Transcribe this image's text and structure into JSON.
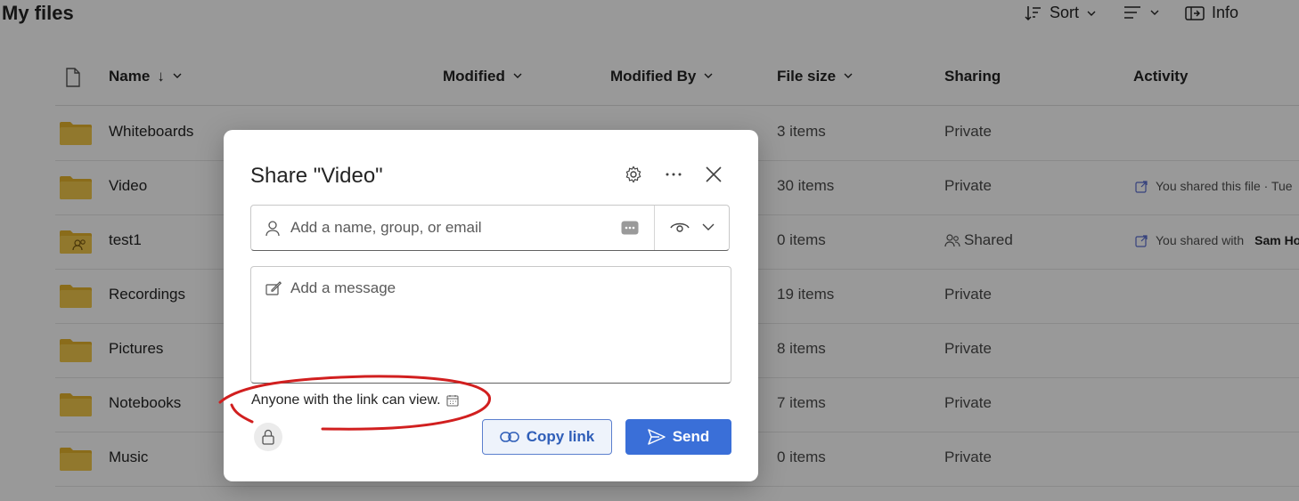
{
  "header": {
    "title": "My files",
    "sort_label": "Sort",
    "info_label": "Info"
  },
  "columns": {
    "name": "Name",
    "name_sort_arrow": "↓",
    "modified": "Modified",
    "modified_by": "Modified By",
    "file_size": "File size",
    "sharing": "Sharing",
    "activity": "Activity"
  },
  "rows": [
    {
      "name": "Whiteboards",
      "size": "3 items",
      "sharing": "Private",
      "activity": "",
      "activity_name": ""
    },
    {
      "name": "Video",
      "size": "30 items",
      "sharing": "Private",
      "activity": "You shared this file · Tue",
      "activity_name": ""
    },
    {
      "name": "test1",
      "size": "0 items",
      "sharing": "Shared",
      "activity": "You shared with",
      "activity_name": "Sam Ho"
    },
    {
      "name": "Recordings",
      "size": "19 items",
      "sharing": "Private",
      "activity": "",
      "activity_name": ""
    },
    {
      "name": "Pictures",
      "size": "8 items",
      "sharing": "Private",
      "activity": "",
      "activity_name": ""
    },
    {
      "name": "Notebooks",
      "size": "7 items",
      "sharing": "Private",
      "activity": "",
      "activity_name": ""
    },
    {
      "name": "Music",
      "size": "0 items",
      "sharing": "Private",
      "activity": "",
      "activity_name": ""
    }
  ],
  "dialog": {
    "title": "Share \"Video\"",
    "people_placeholder": "Add a name, group, or email",
    "message_placeholder": "Add a message",
    "link_info": "Anyone with the link can view.",
    "copy_link_label": "Copy link",
    "send_label": "Send",
    "icons": [
      "settings-icon",
      "more-icon",
      "close-icon",
      "person-icon",
      "contact-card-icon",
      "eye-icon",
      "chevron-down-icon",
      "edit-icon",
      "calendar-icon",
      "lock-icon",
      "link-icon",
      "send-icon"
    ]
  },
  "colors": {
    "accent": "#3a6fd8",
    "folder": "#e7b52c",
    "annotation": "#d11f1f"
  }
}
